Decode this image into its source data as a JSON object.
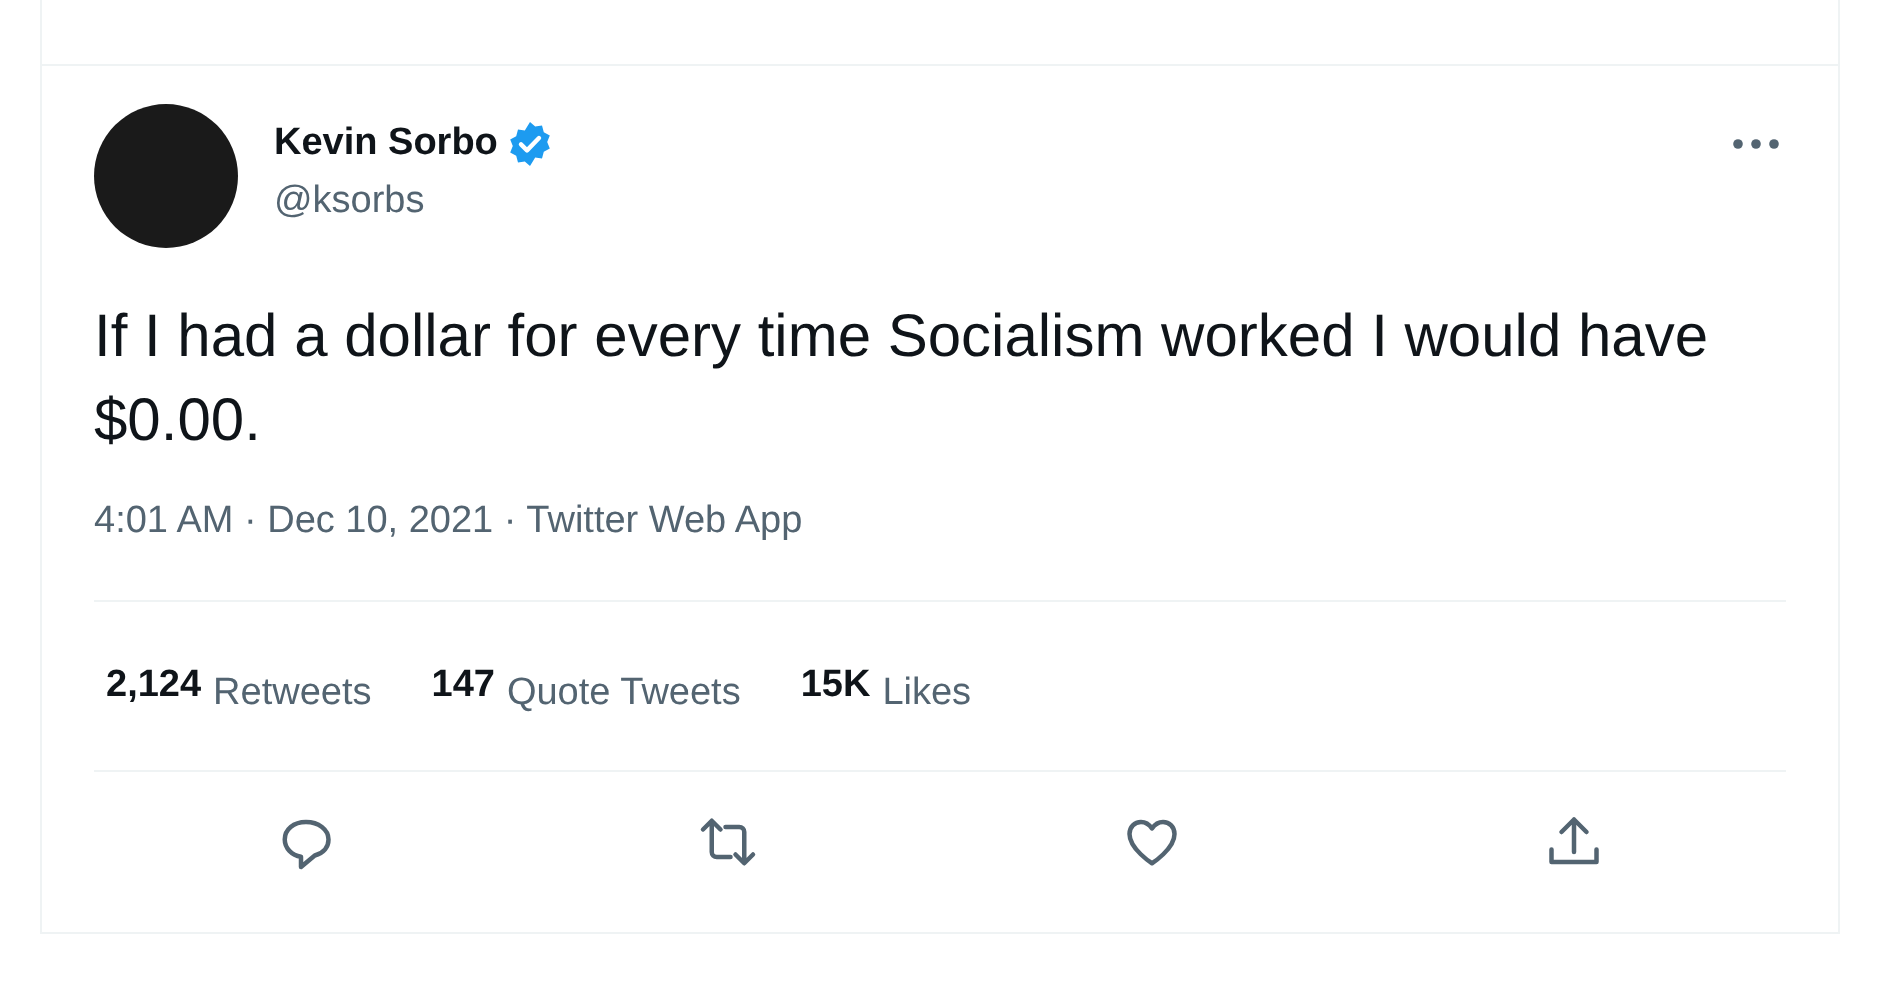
{
  "tweet": {
    "author": {
      "name": "Kevin Sorbo",
      "verified": true,
      "handle": "@ksorbs"
    },
    "text": "If I had a dollar for every time Socialism worked I would have $0.00.",
    "meta": "4:01 AM · Dec 10, 2021 · Twitter Web App",
    "stats": [
      {
        "count": "2,124",
        "label": "Retweets"
      },
      {
        "count": "147",
        "label": "Quote Tweets"
      },
      {
        "count": "15K",
        "label": "Likes"
      }
    ],
    "actions": [
      {
        "kind": "reply"
      },
      {
        "kind": "retweet"
      },
      {
        "kind": "like"
      },
      {
        "kind": "share"
      }
    ]
  }
}
